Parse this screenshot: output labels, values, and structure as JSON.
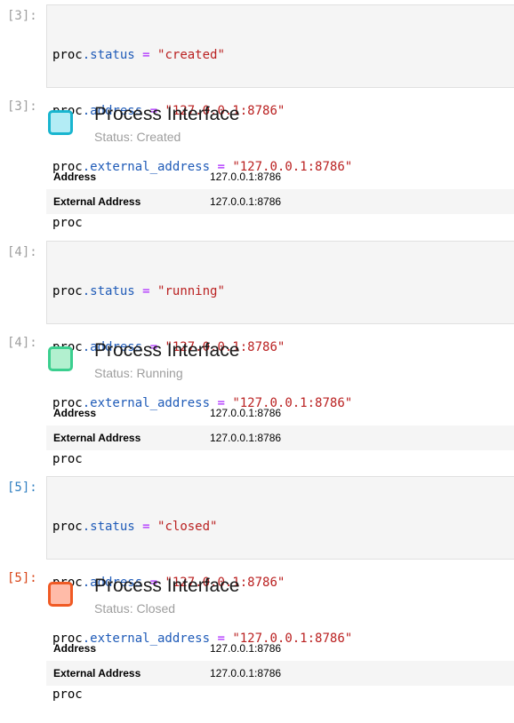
{
  "cells": [
    {
      "in_prompt": "[3]:",
      "out_prompt": "[3]:",
      "code": [
        {
          "var": "proc",
          "attr": ".status",
          "op": " = ",
          "str": "\"created\""
        },
        {
          "var": "proc",
          "attr": ".address",
          "op": " = ",
          "str": "\"127.0.0.1:8786\""
        },
        {
          "var": "proc",
          "attr": ".external_address",
          "op": " = ",
          "str": "\"127.0.0.1:8786\""
        },
        {
          "var": "proc",
          "attr": "",
          "op": "",
          "str": ""
        }
      ],
      "output": {
        "title": "Process Interface",
        "status": "Status: Created",
        "swatch_fill": "#b3ecf5",
        "swatch_border": "#19b5cf",
        "rows": [
          {
            "key": "Address",
            "value": "127.0.0.1:8786"
          },
          {
            "key": "External Address",
            "value": "127.0.0.1:8786"
          }
        ]
      }
    },
    {
      "in_prompt": "[4]:",
      "out_prompt": "[4]:",
      "code": [
        {
          "var": "proc",
          "attr": ".status",
          "op": " = ",
          "str": "\"running\""
        },
        {
          "var": "proc",
          "attr": ".address",
          "op": " = ",
          "str": "\"127.0.0.1:8786\""
        },
        {
          "var": "proc",
          "attr": ".external_address",
          "op": " = ",
          "str": "\"127.0.0.1:8786\""
        },
        {
          "var": "proc",
          "attr": "",
          "op": "",
          "str": ""
        }
      ],
      "output": {
        "title": "Process Interface",
        "status": "Status: Running",
        "swatch_fill": "#b2f0cf",
        "swatch_border": "#3bcf8f",
        "rows": [
          {
            "key": "Address",
            "value": "127.0.0.1:8786"
          },
          {
            "key": "External Address",
            "value": "127.0.0.1:8786"
          }
        ]
      }
    },
    {
      "in_prompt": "[5]:",
      "out_prompt": "[5]:",
      "code": [
        {
          "var": "proc",
          "attr": ".status",
          "op": " = ",
          "str": "\"closed\""
        },
        {
          "var": "proc",
          "attr": ".address",
          "op": " = ",
          "str": "\"127.0.0.1:8786\""
        },
        {
          "var": "proc",
          "attr": ".external_address",
          "op": " = ",
          "str": "\"127.0.0.1:8786\""
        },
        {
          "var": "proc",
          "attr": "",
          "op": "",
          "str": ""
        }
      ],
      "output": {
        "title": "Process Interface",
        "status": "Status: Closed",
        "swatch_fill": "#ffbba8",
        "swatch_border": "#f05a24",
        "rows": [
          {
            "key": "Address",
            "value": "127.0.0.1:8786"
          },
          {
            "key": "External Address",
            "value": "127.0.0.1:8786"
          }
        ]
      }
    }
  ]
}
